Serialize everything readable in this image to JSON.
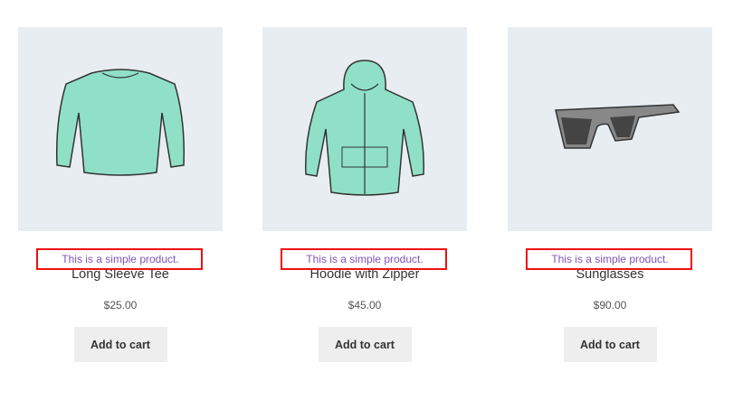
{
  "products": [
    {
      "description": "This is a simple product.",
      "title": "Long Sleeve Tee",
      "price": "$25.00",
      "button": "Add to cart",
      "image": "long-sleeve-tee-image"
    },
    {
      "description": "This is a simple product.",
      "title": "Hoodie with Zipper",
      "price": "$45.00",
      "button": "Add to cart",
      "image": "hoodie-with-zipper-image"
    },
    {
      "description": "This is a simple product.",
      "title": "Sunglasses",
      "price": "$90.00",
      "button": "Add to cart",
      "image": "sunglasses-image"
    }
  ],
  "colors": {
    "highlight": "#ee1111",
    "description": "#7f54b3",
    "thumb_bg": "#e8edf1",
    "button_bg": "#eeeeee",
    "garment": "#8fe0c6"
  }
}
